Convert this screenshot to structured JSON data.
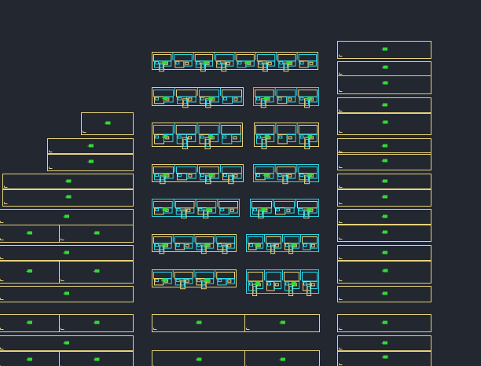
{
  "colors": {
    "background": "#222730",
    "frame": "#e7d27a",
    "detail": "#2fd6e6",
    "label": "#31dc31"
  },
  "label_icon": "green-text-marker"
}
